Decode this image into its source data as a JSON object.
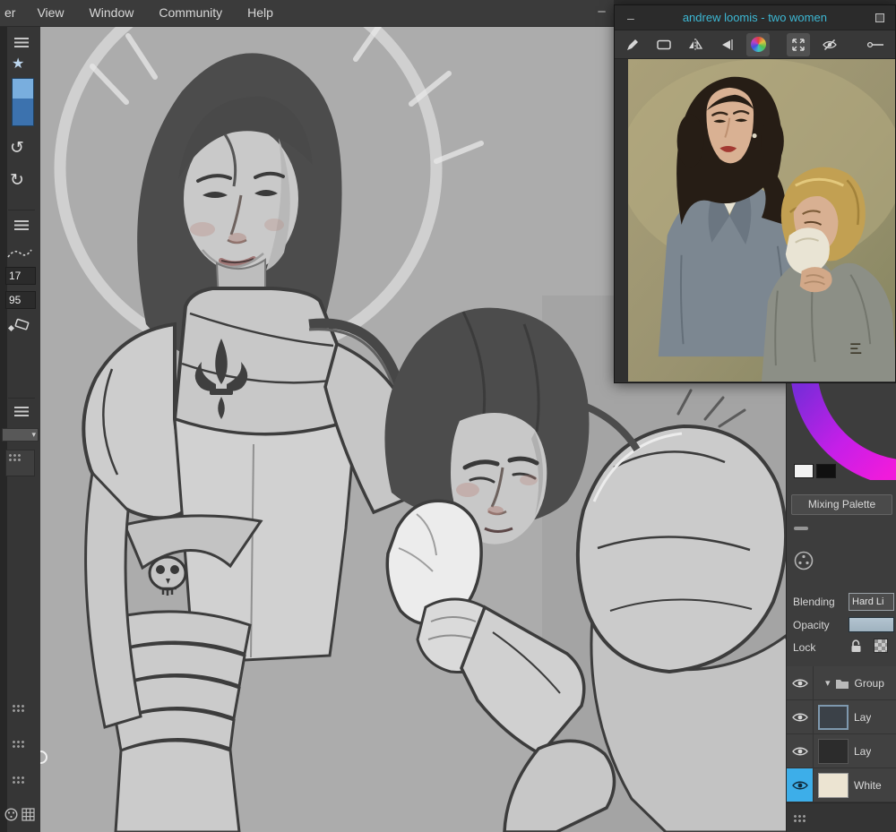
{
  "menu_bar": {
    "items": [
      {
        "label": "er"
      },
      {
        "label": "View"
      },
      {
        "label": "Window"
      },
      {
        "label": "Community"
      },
      {
        "label": "Help"
      }
    ]
  },
  "left_toolbar": {
    "size_value": "17",
    "flow_value": "95"
  },
  "reference_window": {
    "title": "andrew loomis - two women"
  },
  "right_panel": {
    "mixing_palette_button": "Mixing Palette",
    "blending_label": "Blending",
    "blending_value": "Hard Li",
    "opacity_label": "Opacity",
    "lock_label": "Lock",
    "layers": [
      {
        "name": "Group",
        "type": "group",
        "visible": true,
        "selected": false
      },
      {
        "name": "Lay",
        "type": "paint-layer",
        "visible": true,
        "selected": false
      },
      {
        "name": "Lay",
        "type": "paint-layer",
        "visible": true,
        "selected": false
      },
      {
        "name": "White",
        "type": "paint-layer",
        "visible": true,
        "selected": true
      }
    ]
  },
  "icons": {
    "hamburger": "≡",
    "undo": "↺",
    "redo": "↻",
    "star": "★",
    "chevron_down": "▾",
    "minimize": "–",
    "combo_arrow": "▾",
    "titlebar_dash": "–"
  },
  "colors": {
    "accent": "#3daee9",
    "title_text": "#3db8d4",
    "canvas_bg": "#acacac",
    "panel_bg": "#3d3d3d"
  }
}
